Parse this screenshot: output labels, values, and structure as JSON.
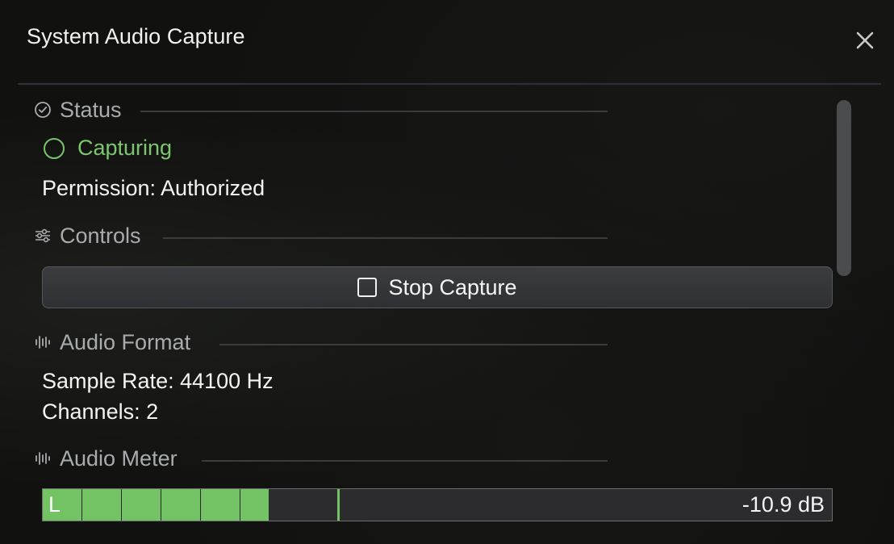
{
  "window": {
    "title": "System Audio Capture",
    "close_icon": "close-icon"
  },
  "status": {
    "header": "Status",
    "icon": "checkmark-circle-icon",
    "state": "Capturing",
    "state_color": "#7cc66f",
    "permission": "Permission: Authorized"
  },
  "controls": {
    "header": "Controls",
    "icon": "sliders-icon",
    "stop_label": "Stop Capture",
    "stop_icon": "stop-square-icon"
  },
  "audio_format": {
    "header": "Audio Format",
    "icon": "waveform-icon",
    "sample_rate": "Sample Rate: 44100 Hz",
    "channels": "Channels: 2"
  },
  "audio_meter": {
    "header": "Audio Meter",
    "icon": "waveform-icon",
    "channel": "L",
    "level_db": "-10.9 dB",
    "level_fraction": 0.286,
    "peak_fraction": 0.373,
    "meter_color": "#73c364"
  }
}
